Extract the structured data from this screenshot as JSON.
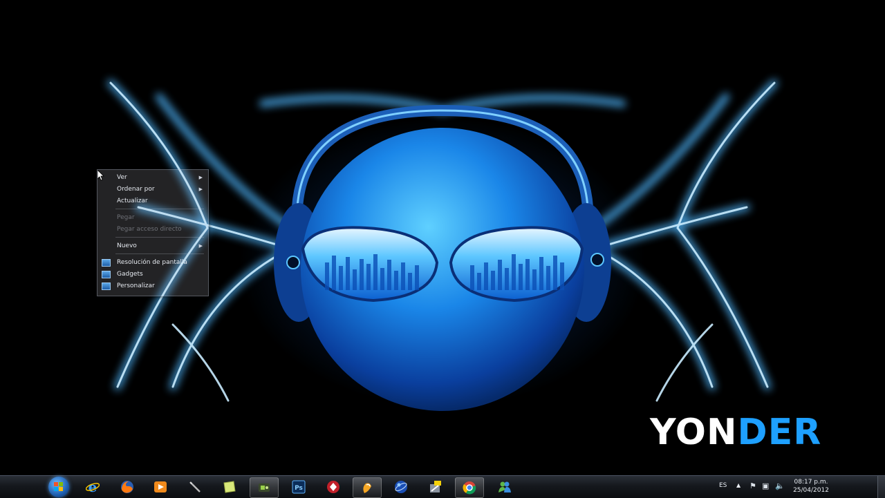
{
  "wallpaper": {
    "logo_part1": "YON",
    "logo_part2": "DER"
  },
  "context_menu": {
    "items": [
      {
        "label": "Ver",
        "submenu": true,
        "enabled": true
      },
      {
        "label": "Ordenar por",
        "submenu": true,
        "enabled": true
      },
      {
        "label": "Actualizar",
        "submenu": false,
        "enabled": true
      },
      {
        "label": "Pegar",
        "submenu": false,
        "enabled": false
      },
      {
        "label": "Pegar acceso directo",
        "submenu": false,
        "enabled": false
      },
      {
        "label": "Nuevo",
        "submenu": true,
        "enabled": true
      },
      {
        "label": "Resolución de pantalla",
        "submenu": false,
        "enabled": true
      },
      {
        "label": "Gadgets",
        "submenu": false,
        "enabled": true
      },
      {
        "label": "Personalizar",
        "submenu": false,
        "enabled": true
      }
    ]
  },
  "taskbar": {
    "pinned": [
      {
        "name": "internet-explorer",
        "active": false
      },
      {
        "name": "firefox",
        "active": false
      },
      {
        "name": "media-player",
        "active": false
      },
      {
        "name": "pen-tool",
        "active": false
      },
      {
        "name": "sticky-notes",
        "active": false
      },
      {
        "name": "camtasia",
        "active": true
      },
      {
        "name": "photoshop",
        "active": false
      },
      {
        "name": "avatar-app",
        "active": false
      },
      {
        "name": "fl-studio",
        "active": true
      },
      {
        "name": "globe-app",
        "active": false
      },
      {
        "name": "counter-app",
        "active": false
      },
      {
        "name": "chrome",
        "active": true
      },
      {
        "name": "messenger",
        "active": false
      }
    ],
    "colors": {
      "accent": "#1ea0ff"
    }
  },
  "tray": {
    "language": "ES",
    "time": "08:17 p.m.",
    "date": "25/04/2012"
  }
}
